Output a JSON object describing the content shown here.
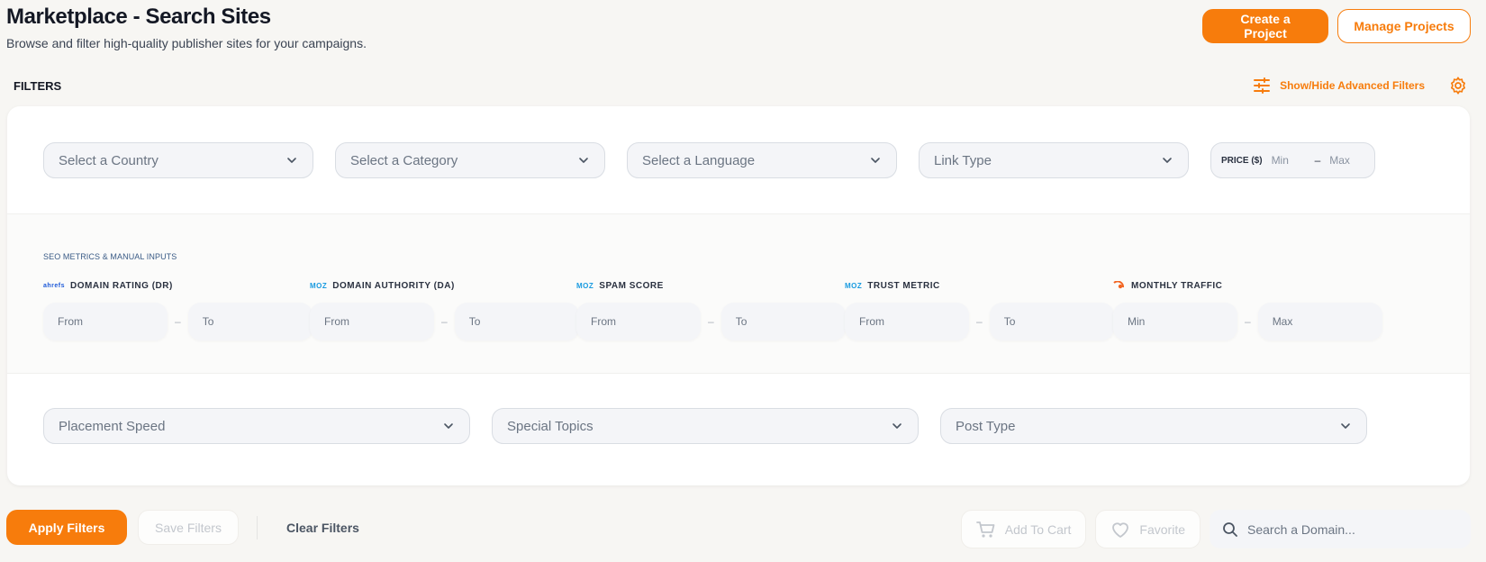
{
  "header": {
    "title": "Marketplace - Search Sites",
    "subtitle": "Browse and filter high-quality publisher sites for your campaigns."
  },
  "top_actions": {
    "create_project": "Create a Project",
    "manage_projects": "Manage Projects"
  },
  "filters": {
    "label": "FILTERS",
    "advanced_toggle": "Show/Hide Advanced Filters",
    "country_placeholder": "Select a Country",
    "category_placeholder": "Select a Category",
    "language_placeholder": "Select a Language",
    "link_type_placeholder": "Link Type",
    "price": {
      "label": "PRICE ($)",
      "min": "Min",
      "sep": "–",
      "max": "Max"
    },
    "seo_title": "SEO METRICS & MANUAL INPUTS",
    "metrics": [
      {
        "label": "DOMAIN RATING (DR)",
        "logo": "ahrefs",
        "from": "From",
        "to": "To",
        "sep": "–"
      },
      {
        "label": "DOMAIN AUTHORITY (DA)",
        "logo": "MOZ",
        "from": "From",
        "to": "To",
        "sep": "–"
      },
      {
        "label": "SPAM SCORE",
        "logo": "MOZ",
        "from": "From",
        "to": "To",
        "sep": "–"
      },
      {
        "label": "TRUST METRIC",
        "logo": "MOZ",
        "from": "From",
        "to": "To",
        "sep": "–"
      },
      {
        "label": "MONTHLY TRAFFIC",
        "logo": "semrush-icon",
        "from": "Min",
        "to": "Max",
        "sep": "–"
      }
    ],
    "placement_speed_placeholder": "Placement Speed",
    "special_topics_placeholder": "Special Topics",
    "post_type_placeholder": "Post Type"
  },
  "bottom": {
    "apply": "Apply Filters",
    "save": "Save Filters",
    "clear": "Clear Filters",
    "add_to_cart": "Add To Cart",
    "favorite": "Favorite",
    "search_placeholder": "Search a Domain..."
  },
  "colors": {
    "accent": "#f77c0c",
    "background": "#f7f6f3",
    "field": "#f4f5f8"
  }
}
